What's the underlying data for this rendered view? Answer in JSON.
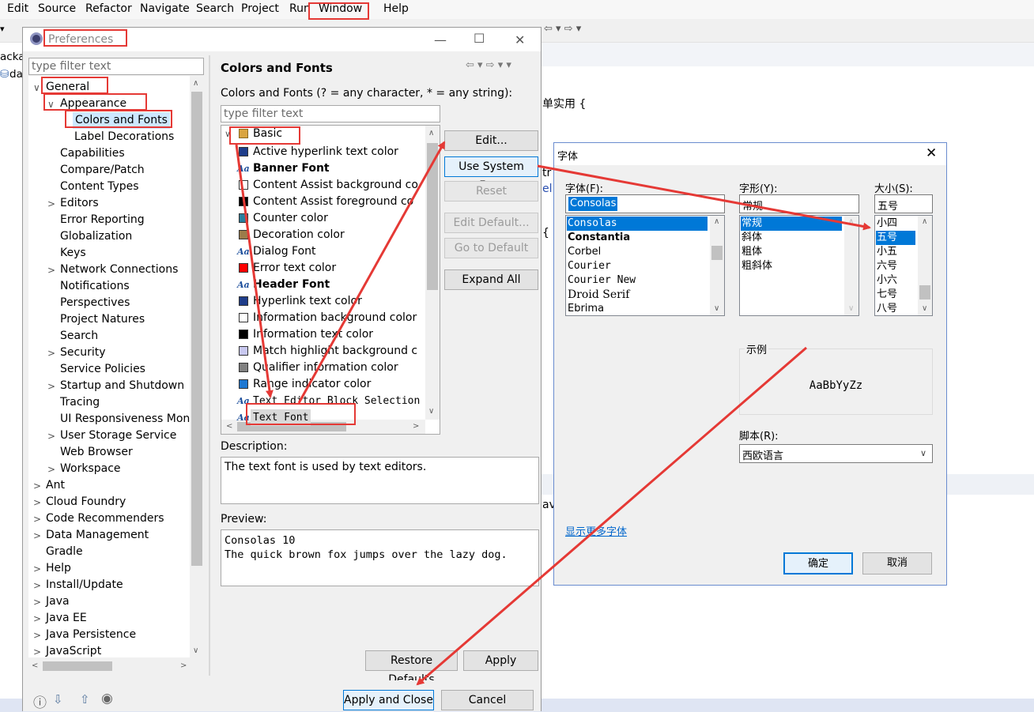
{
  "menubar": {
    "items": [
      "Edit",
      "Source",
      "Refactor",
      "Navigate",
      "Search",
      "Project",
      "Run",
      "Window",
      "Help"
    ]
  },
  "background": {
    "left_labels": [
      "acka",
      "da"
    ],
    "code_lines": [
      "单实用 {",
      "tr",
      "el",
      "{",
      "av"
    ]
  },
  "preferences": {
    "title": "Preferences",
    "filter_placeholder": "type filter text",
    "tree": [
      {
        "label": "General",
        "indent": 0,
        "exp": "v"
      },
      {
        "label": "Appearance",
        "indent": 1,
        "exp": "v"
      },
      {
        "label": "Colors and Fonts",
        "indent": 2,
        "exp": "",
        "selected": true
      },
      {
        "label": "Label Decorations",
        "indent": 2,
        "exp": ""
      },
      {
        "label": "Capabilities",
        "indent": 1,
        "exp": ""
      },
      {
        "label": "Compare/Patch",
        "indent": 1,
        "exp": ""
      },
      {
        "label": "Content Types",
        "indent": 1,
        "exp": ""
      },
      {
        "label": "Editors",
        "indent": 1,
        "exp": ">"
      },
      {
        "label": "Error Reporting",
        "indent": 1,
        "exp": ""
      },
      {
        "label": "Globalization",
        "indent": 1,
        "exp": ""
      },
      {
        "label": "Keys",
        "indent": 1,
        "exp": ""
      },
      {
        "label": "Network Connections",
        "indent": 1,
        "exp": ">"
      },
      {
        "label": "Notifications",
        "indent": 1,
        "exp": ""
      },
      {
        "label": "Perspectives",
        "indent": 1,
        "exp": ""
      },
      {
        "label": "Project Natures",
        "indent": 1,
        "exp": ""
      },
      {
        "label": "Search",
        "indent": 1,
        "exp": ""
      },
      {
        "label": "Security",
        "indent": 1,
        "exp": ">"
      },
      {
        "label": "Service Policies",
        "indent": 1,
        "exp": ""
      },
      {
        "label": "Startup and Shutdown",
        "indent": 1,
        "exp": ">"
      },
      {
        "label": "Tracing",
        "indent": 1,
        "exp": ""
      },
      {
        "label": "UI Responsiveness Monit",
        "indent": 1,
        "exp": ""
      },
      {
        "label": "User Storage Service",
        "indent": 1,
        "exp": ">"
      },
      {
        "label": "Web Browser",
        "indent": 1,
        "exp": ""
      },
      {
        "label": "Workspace",
        "indent": 1,
        "exp": ">"
      },
      {
        "label": "Ant",
        "indent": 0,
        "exp": ">"
      },
      {
        "label": "Cloud Foundry",
        "indent": 0,
        "exp": ">"
      },
      {
        "label": "Code Recommenders",
        "indent": 0,
        "exp": ">"
      },
      {
        "label": "Data Management",
        "indent": 0,
        "exp": ">"
      },
      {
        "label": "Gradle",
        "indent": 0,
        "exp": ""
      },
      {
        "label": "Help",
        "indent": 0,
        "exp": ">"
      },
      {
        "label": "Install/Update",
        "indent": 0,
        "exp": ">"
      },
      {
        "label": "Java",
        "indent": 0,
        "exp": ">"
      },
      {
        "label": "Java EE",
        "indent": 0,
        "exp": ">"
      },
      {
        "label": "Java Persistence",
        "indent": 0,
        "exp": ">"
      },
      {
        "label": "JavaScript",
        "indent": 0,
        "exp": ">"
      }
    ],
    "page_title": "Colors and Fonts",
    "page_subtitle": "Colors and Fonts (? = any character, * = any string):",
    "page_filter_placeholder": "type filter text",
    "category": "Basic",
    "items": [
      {
        "label": "Active hyperlink text color",
        "kind": "color",
        "color": "#1f3d8a"
      },
      {
        "label": "Banner Font",
        "kind": "font",
        "bold": true
      },
      {
        "label": "Content Assist background co",
        "kind": "color",
        "color": "#ffffff"
      },
      {
        "label": "Content Assist foreground co",
        "kind": "color",
        "color": "#000000"
      },
      {
        "label": "Counter color",
        "kind": "color",
        "color": "#2a7f9e"
      },
      {
        "label": "Decoration color",
        "kind": "color",
        "color": "#9c7c4a"
      },
      {
        "label": "Dialog Font",
        "kind": "font"
      },
      {
        "label": "Error text color",
        "kind": "color",
        "color": "#ff0000"
      },
      {
        "label": "Header Font",
        "kind": "font",
        "bold": true
      },
      {
        "label": "Hyperlink text color",
        "kind": "color",
        "color": "#1f3d8a"
      },
      {
        "label": "Information background color",
        "kind": "color",
        "color": "#ffffff"
      },
      {
        "label": "Information text color",
        "kind": "color",
        "color": "#000000"
      },
      {
        "label": "Match highlight background c",
        "kind": "color",
        "color": "#c8c8f0"
      },
      {
        "label": "Qualifier information color",
        "kind": "color",
        "color": "#808080"
      },
      {
        "label": "Range indicator color",
        "kind": "color",
        "color": "#1e78d2"
      },
      {
        "label": "Text Editor Block Selection",
        "kind": "font",
        "mono": true
      },
      {
        "label": "Text Font",
        "kind": "font",
        "mono": true,
        "selected": true
      }
    ],
    "buttons": {
      "edit": "Edit...",
      "use_system_font": "Use System Font",
      "reset": "Reset",
      "edit_default": "Edit Default...",
      "go_to_default": "Go to Default",
      "expand_all": "Expand All",
      "restore_defaults": "Restore Defaults",
      "apply": "Apply",
      "apply_and_close": "Apply and Close",
      "cancel": "Cancel"
    },
    "description_label": "Description:",
    "description": "The text font is used by text editors.",
    "preview_label": "Preview:",
    "preview_lines": [
      "Consolas 10",
      "The quick brown fox jumps over the lazy dog."
    ]
  },
  "font_dialog": {
    "title": "字体",
    "font_label": "字体(F):",
    "style_label": "字形(Y):",
    "size_label": "大小(S):",
    "font_value": "Consolas",
    "style_value": "常规",
    "size_value": "五号",
    "fonts": [
      "Consolas",
      "Constantia",
      "Corbel",
      "Courier",
      "Courier New",
      "Droid Serif",
      "Ebrima"
    ],
    "styles": [
      "常规",
      "斜体",
      "粗体",
      "粗斜体"
    ],
    "sizes": [
      "小四",
      "五号",
      "小五",
      "六号",
      "小六",
      "七号",
      "八号"
    ],
    "sample_label": "示例",
    "sample_text": "AaBbYyZz",
    "script_label": "脚本(R):",
    "script_value": "西欧语言",
    "more_fonts_link": "显示更多字体",
    "ok": "确定",
    "cancel": "取消"
  }
}
